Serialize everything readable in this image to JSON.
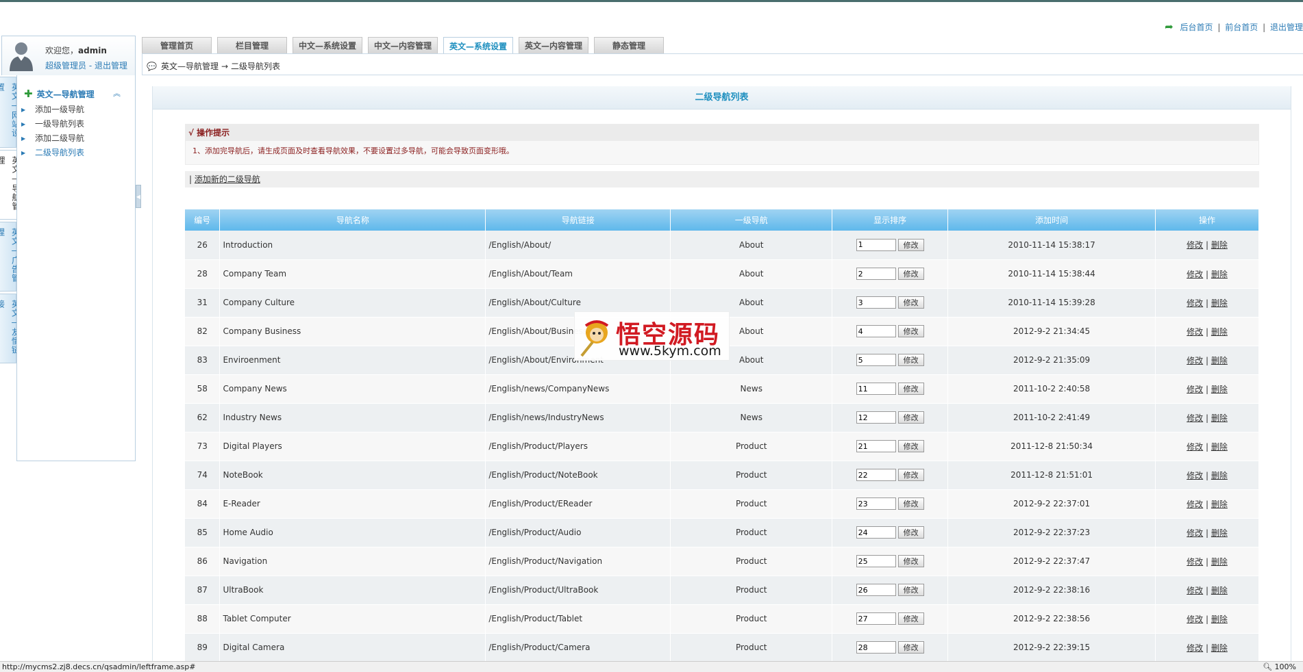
{
  "header": {
    "links": [
      "后台首页",
      "前台首页",
      "退出管理"
    ],
    "separator": "|"
  },
  "user": {
    "welcome_prefix": "欢迎您，",
    "username": "admin",
    "role": "超级管理员",
    "dash": " - ",
    "logout": "退出管理"
  },
  "side_tabs": [
    "英文—网站设置",
    "英文—导航管理",
    "英文—广告管理",
    "英文—友情链接"
  ],
  "menu": {
    "title": "英文—导航管理",
    "collapse_icon": "double-chevron-up",
    "items": [
      {
        "label": "添加一级导航"
      },
      {
        "label": "一级导航列表"
      },
      {
        "label": "添加二级导航"
      },
      {
        "label": "二级导航列表"
      }
    ]
  },
  "tabs": [
    {
      "label": "管理首页"
    },
    {
      "label": "栏目管理"
    },
    {
      "label": "中文—系统设置"
    },
    {
      "label": "中文—内容管理"
    },
    {
      "label": "英文—系统设置"
    },
    {
      "label": "英文—内容管理"
    },
    {
      "label": "静态管理"
    }
  ],
  "breadcrumb": {
    "part1": "英文—导航管理",
    "arrow": "→",
    "part2": "二级导航列表"
  },
  "main": {
    "title": "二级导航列表",
    "tip_title": "√ 操作提示",
    "tip_text": "1、添加完导航后，请生成页面及时查看导航效果，不要设置过多导航，可能会导致页面变形哦。",
    "add_prefix": "| ",
    "add_link": "添加新的二级导航"
  },
  "table": {
    "headers": [
      "编号",
      "导航名称",
      "导航链接",
      "一级导航",
      "显示排序",
      "添加时间",
      "操作"
    ],
    "modify_label": "修改",
    "edit_label": "修改",
    "op_sep": " | ",
    "delete_label": "删除",
    "rows": [
      {
        "id": "26",
        "name": "Introduction",
        "url": "/English/About/",
        "parent": "About",
        "order": "1",
        "time": "2010-11-14 15:38:17"
      },
      {
        "id": "28",
        "name": "Company Team",
        "url": "/English/About/Team",
        "parent": "About",
        "order": "2",
        "time": "2010-11-14 15:38:44"
      },
      {
        "id": "31",
        "name": "Company Culture",
        "url": "/English/About/Culture",
        "parent": "About",
        "order": "3",
        "time": "2010-11-14 15:39:28"
      },
      {
        "id": "82",
        "name": "Company Business",
        "url": "/English/About/Business",
        "parent": "About",
        "order": "4",
        "time": "2012-9-2 21:34:45"
      },
      {
        "id": "83",
        "name": "Enviroenment",
        "url": "/English/About/Environment",
        "parent": "About",
        "order": "5",
        "time": "2012-9-2 21:35:09"
      },
      {
        "id": "58",
        "name": "Company News",
        "url": "/English/news/CompanyNews",
        "parent": "News",
        "order": "11",
        "time": "2011-10-2 2:40:58"
      },
      {
        "id": "62",
        "name": "Industry News",
        "url": "/English/news/IndustryNews",
        "parent": "News",
        "order": "12",
        "time": "2011-10-2 2:41:49"
      },
      {
        "id": "73",
        "name": "Digital Players",
        "url": "/English/Product/Players",
        "parent": "Product",
        "order": "21",
        "time": "2011-12-8 21:50:34"
      },
      {
        "id": "74",
        "name": "NoteBook",
        "url": "/English/Product/NoteBook",
        "parent": "Product",
        "order": "22",
        "time": "2011-12-8 21:51:01"
      },
      {
        "id": "84",
        "name": "E-Reader",
        "url": "/English/Product/EReader",
        "parent": "Product",
        "order": "23",
        "time": "2012-9-2 22:37:01"
      },
      {
        "id": "85",
        "name": "Home Audio",
        "url": "/English/Product/Audio",
        "parent": "Product",
        "order": "24",
        "time": "2012-9-2 22:37:23"
      },
      {
        "id": "86",
        "name": "Navigation",
        "url": "/English/Product/Navigation",
        "parent": "Product",
        "order": "25",
        "time": "2012-9-2 22:37:47"
      },
      {
        "id": "87",
        "name": "UltraBook",
        "url": "/English/Product/UltraBook",
        "parent": "Product",
        "order": "26",
        "time": "2012-9-2 22:38:16"
      },
      {
        "id": "88",
        "name": "Tablet Computer",
        "url": "/English/Product/Tablet",
        "parent": "Product",
        "order": "27",
        "time": "2012-9-2 22:38:56"
      },
      {
        "id": "89",
        "name": "Digital Camera",
        "url": "/English/Product/Camera",
        "parent": "Product",
        "order": "28",
        "time": "2012-9-2 22:39:15"
      }
    ]
  },
  "watermark": {
    "title": "悟空源码",
    "url": "www.5kym.com"
  },
  "status_bar": {
    "url": "http://mycms2.zj8.decs.cn/qsadmin/leftframe.asp#",
    "zoom": "100%"
  },
  "colors": {
    "accent": "#1e8fbf",
    "table_header": "#5fb8eb",
    "tip_text": "#8a1e1e"
  }
}
